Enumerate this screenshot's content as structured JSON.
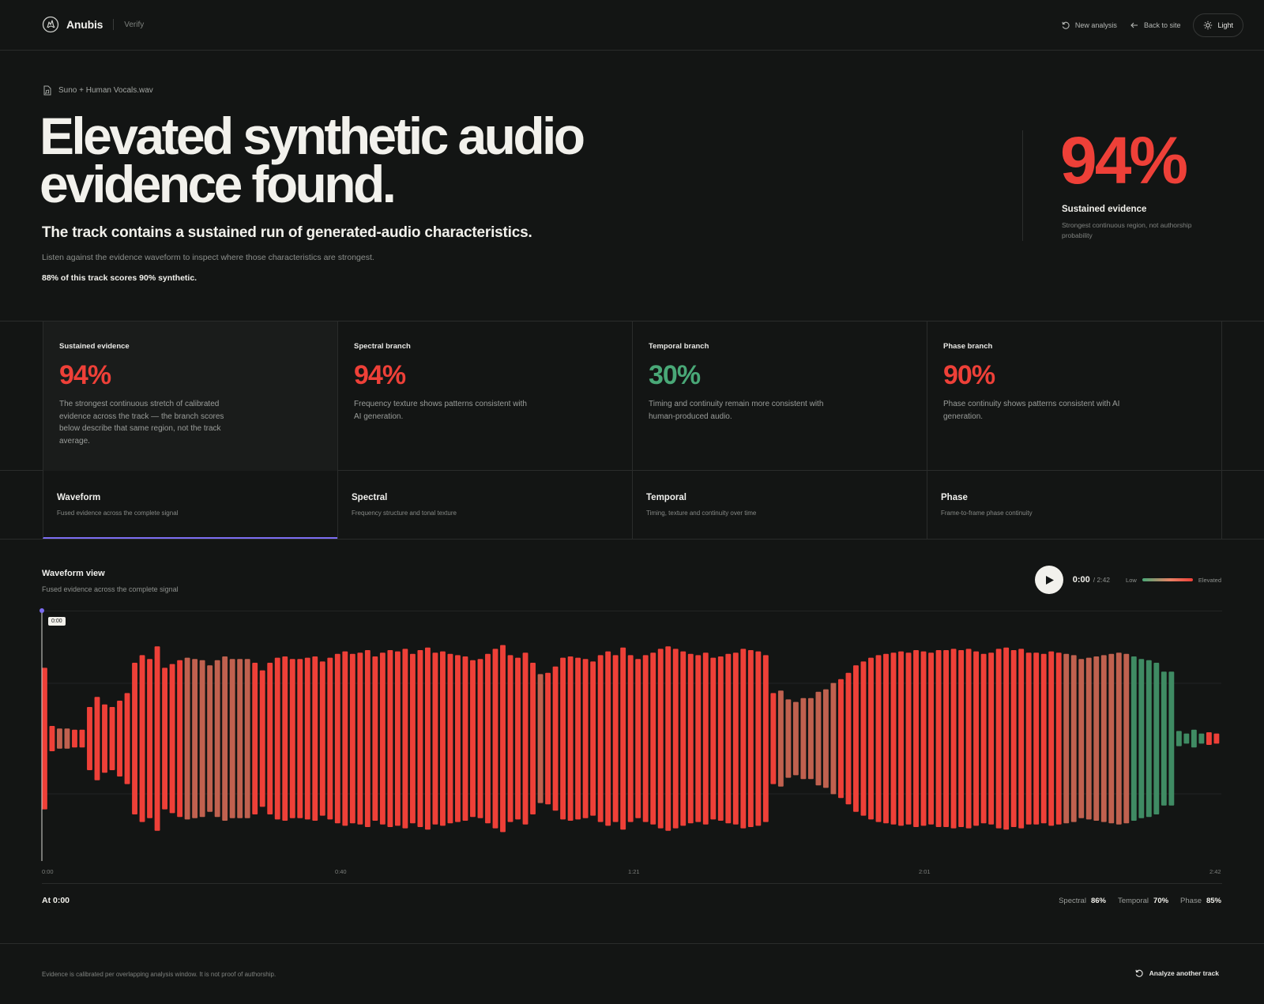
{
  "app": {
    "name": "Anubis",
    "section": "Verify",
    "logo_icon": "anubis-logo-icon"
  },
  "nav": {
    "new_analysis": "New analysis",
    "back_to_site": "Back to site",
    "theme_toggle": "Light"
  },
  "file": {
    "name": "Suno + Human Vocals.wav"
  },
  "hero": {
    "headline": "Elevated synthetic audio evidence found.",
    "subhead": "The track contains a sustained run of generated-audio characteristics.",
    "description": "Listen against the evidence waveform to inspect where those characteristics are strongest.",
    "stat_line": "88% of this track scores 90% synthetic.",
    "score": "94%",
    "score_label": "Sustained evidence",
    "score_note": "Strongest continuous region, not authorship probability"
  },
  "cards": [
    {
      "title": "Sustained evidence",
      "score": "94%",
      "tone": "red",
      "description": "The strongest continuous stretch of calibrated evidence across the track — the branch scores below describe that same region, not the track average."
    },
    {
      "title": "Spectral branch",
      "score": "94%",
      "tone": "red",
      "description": "Frequency texture shows patterns consistent with AI generation."
    },
    {
      "title": "Temporal branch",
      "score": "30%",
      "tone": "green",
      "description": "Timing and continuity remain more consistent with human-produced audio."
    },
    {
      "title": "Phase branch",
      "score": "90%",
      "tone": "red",
      "description": "Phase continuity shows patterns consistent with AI generation."
    }
  ],
  "tabs": [
    {
      "title": "Waveform",
      "description": "Fused evidence across the complete signal",
      "active": true
    },
    {
      "title": "Spectral",
      "description": "Frequency structure and tonal texture",
      "active": false
    },
    {
      "title": "Temporal",
      "description": "Timing, texture and continuity over time",
      "active": false
    },
    {
      "title": "Phase",
      "description": "Frame-to-frame phase continuity",
      "active": false
    }
  ],
  "waveform": {
    "title": "Waveform view",
    "subtitle": "Fused evidence across the complete signal",
    "current_time": "0:00",
    "total_time": "/ 2:42",
    "playhead_label": "0:00",
    "legend_low": "Low",
    "legend_high": "Elevated",
    "ticks": [
      "0:00",
      "0:40",
      "1:21",
      "2:01",
      "2:42"
    ],
    "at_label": "At 0:00",
    "metrics": [
      {
        "label": "Spectral",
        "value": "86%"
      },
      {
        "label": "Temporal",
        "value": "70%"
      },
      {
        "label": "Phase",
        "value": "85%"
      }
    ],
    "colors": {
      "red": "#ee4038",
      "muted_red": "#c0614f",
      "green": "#3f8b63",
      "accent": "#7c6df2"
    },
    "bars": {
      "amplitudes": [
        0.56,
        0.1,
        0.08,
        0.08,
        0.07,
        0.07,
        0.25,
        0.33,
        0.27,
        0.25,
        0.3,
        0.36,
        0.6,
        0.66,
        0.63,
        0.73,
        0.56,
        0.59,
        0.62,
        0.64,
        0.63,
        0.62,
        0.58,
        0.62,
        0.65,
        0.63,
        0.63,
        0.63,
        0.6,
        0.54,
        0.6,
        0.64,
        0.65,
        0.63,
        0.63,
        0.64,
        0.65,
        0.61,
        0.64,
        0.67,
        0.69,
        0.67,
        0.68,
        0.7,
        0.65,
        0.68,
        0.7,
        0.69,
        0.71,
        0.67,
        0.7,
        0.72,
        0.68,
        0.69,
        0.67,
        0.66,
        0.65,
        0.62,
        0.63,
        0.67,
        0.71,
        0.74,
        0.66,
        0.64,
        0.68,
        0.6,
        0.51,
        0.52,
        0.57,
        0.64,
        0.65,
        0.64,
        0.63,
        0.61,
        0.66,
        0.69,
        0.66,
        0.72,
        0.66,
        0.63,
        0.66,
        0.68,
        0.71,
        0.73,
        0.71,
        0.69,
        0.67,
        0.66,
        0.68,
        0.64,
        0.65,
        0.67,
        0.68,
        0.71,
        0.7,
        0.69,
        0.66,
        0.36,
        0.38,
        0.31,
        0.29,
        0.32,
        0.32,
        0.37,
        0.39,
        0.44,
        0.47,
        0.52,
        0.58,
        0.61,
        0.64,
        0.66,
        0.67,
        0.68,
        0.69,
        0.68,
        0.7,
        0.69,
        0.68,
        0.7,
        0.7,
        0.71,
        0.7,
        0.71,
        0.69,
        0.67,
        0.68,
        0.71,
        0.72,
        0.7,
        0.71,
        0.68,
        0.68,
        0.67,
        0.69,
        0.68,
        0.67,
        0.66,
        0.63,
        0.64,
        0.65,
        0.66,
        0.67,
        0.68,
        0.67,
        0.65,
        0.63,
        0.62,
        0.6,
        0.53,
        0.53,
        0.06,
        0.04,
        0.07,
        0.04,
        0.05,
        0.04
      ],
      "scores": [
        0.92,
        0.8,
        0.78,
        0.78,
        0.8,
        0.82,
        0.9,
        0.92,
        0.9,
        0.88,
        0.9,
        0.95,
        0.95,
        0.9,
        0.92,
        0.94,
        0.9,
        0.85,
        0.82,
        0.7,
        0.62,
        0.6,
        0.6,
        0.62,
        0.65,
        0.7,
        0.72,
        0.75,
        0.8,
        0.85,
        0.88,
        0.9,
        0.92,
        0.9,
        0.88,
        0.9,
        0.92,
        0.9,
        0.92,
        0.94,
        0.94,
        0.92,
        0.92,
        0.94,
        0.94,
        0.92,
        0.95,
        0.94,
        0.94,
        0.92,
        0.9,
        0.88,
        0.85,
        0.88,
        0.88,
        0.88,
        0.88,
        0.85,
        0.82,
        0.88,
        0.95,
        0.96,
        0.92,
        0.9,
        0.88,
        0.8,
        0.78,
        0.95,
        0.95,
        0.94,
        0.94,
        0.92,
        0.9,
        0.9,
        0.9,
        0.92,
        0.94,
        0.95,
        0.94,
        0.92,
        0.9,
        0.88,
        0.92,
        0.94,
        0.94,
        0.95,
        0.94,
        0.92,
        0.92,
        0.94,
        0.95,
        0.94,
        0.92,
        0.9,
        0.9,
        0.88,
        0.85,
        0.8,
        0.78,
        0.75,
        0.72,
        0.72,
        0.72,
        0.74,
        0.76,
        0.78,
        0.8,
        0.82,
        0.85,
        0.88,
        0.9,
        0.92,
        0.94,
        0.92,
        0.9,
        0.9,
        0.92,
        0.94,
        0.95,
        0.96,
        0.96,
        0.95,
        0.94,
        0.94,
        0.95,
        0.95,
        0.94,
        0.92,
        0.9,
        0.88,
        0.88,
        0.86,
        0.84,
        0.82,
        0.8,
        0.8,
        0.78,
        0.78,
        0.76,
        0.75,
        0.74,
        0.72,
        0.7,
        0.7,
        0.68,
        0.2,
        0.2,
        0.18,
        0.2,
        0.22,
        0.2,
        0.18,
        0.2,
        0.2,
        0.18
      ]
    }
  }
}
